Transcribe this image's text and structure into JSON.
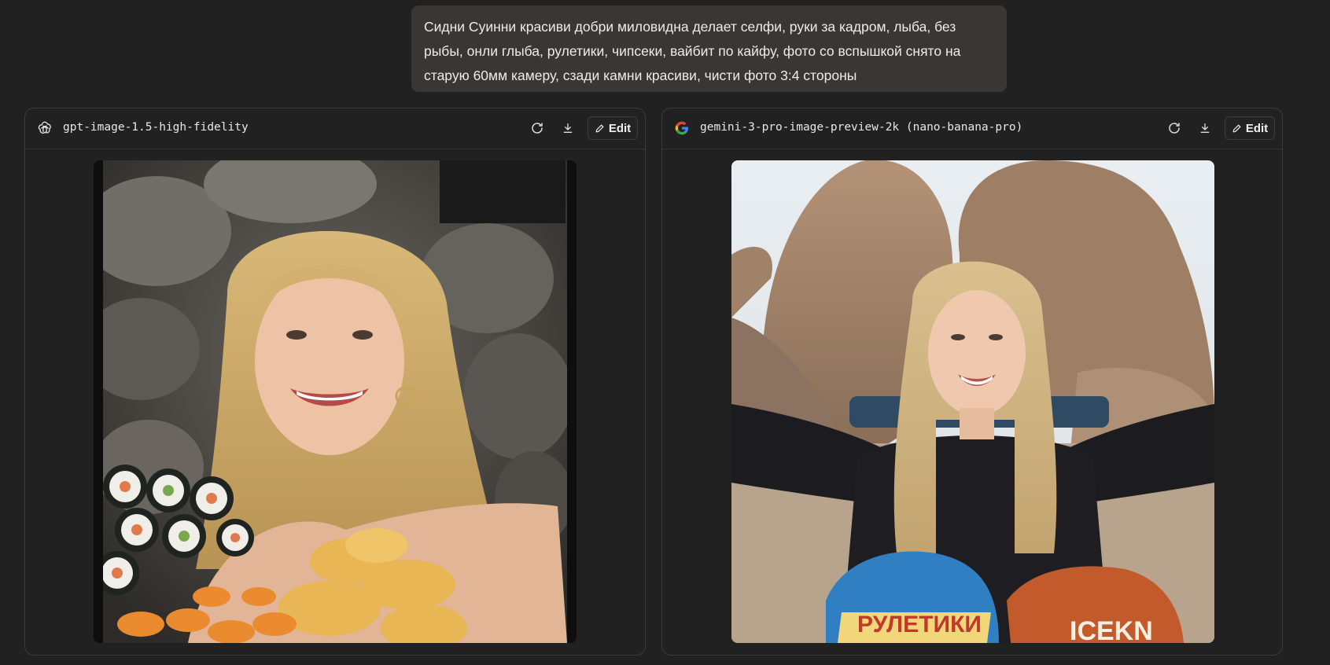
{
  "prompt": {
    "line1": "Сидни Суинни красиви добри миловидна делает селфи, руки за кадром, лыба, без",
    "line2": "рыбы, онли глыба, рулетики, чипсеки, вайбит по кайфу, фото со вспышкой снято на",
    "line3": "старую 60мм камеру, сзади камни красиви, чисти фото 3:4 стороны"
  },
  "panels": [
    {
      "model": "gpt-image-1.5-high-fidelity",
      "logo_icon": "openai-logo-icon",
      "edit_label": "Edit"
    },
    {
      "model": "gemini-3-pro-image-preview-2k (nano-banana-pro)",
      "logo_icon": "google-logo-icon",
      "edit_label": "Edit",
      "bag_text": "РУЛЕТИКИ",
      "bag_text_2": "ICEKN"
    }
  ],
  "colors": {
    "background": "#212121",
    "bubble": "#3a3634",
    "panel_border": "#3a3a3a"
  }
}
